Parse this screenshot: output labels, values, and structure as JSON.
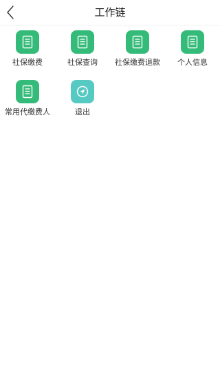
{
  "header": {
    "title": "工作链",
    "back_icon": "chevron-left-icon"
  },
  "colors": {
    "tile_green": "#35bb79",
    "tile_teal": "#57c9c3",
    "icon_white": "#ffffff",
    "divider": "#f0f0f0"
  },
  "tiles": [
    {
      "label": "社保缴费",
      "icon": "document-icon"
    },
    {
      "label": "社保查询",
      "icon": "document-icon"
    },
    {
      "label": "社保缴费退款",
      "icon": "document-icon"
    },
    {
      "label": "个人信息",
      "icon": "document-icon"
    },
    {
      "label": "常用代缴费人",
      "icon": "document-icon"
    },
    {
      "label": "退出",
      "icon": "exit-send-icon"
    }
  ]
}
